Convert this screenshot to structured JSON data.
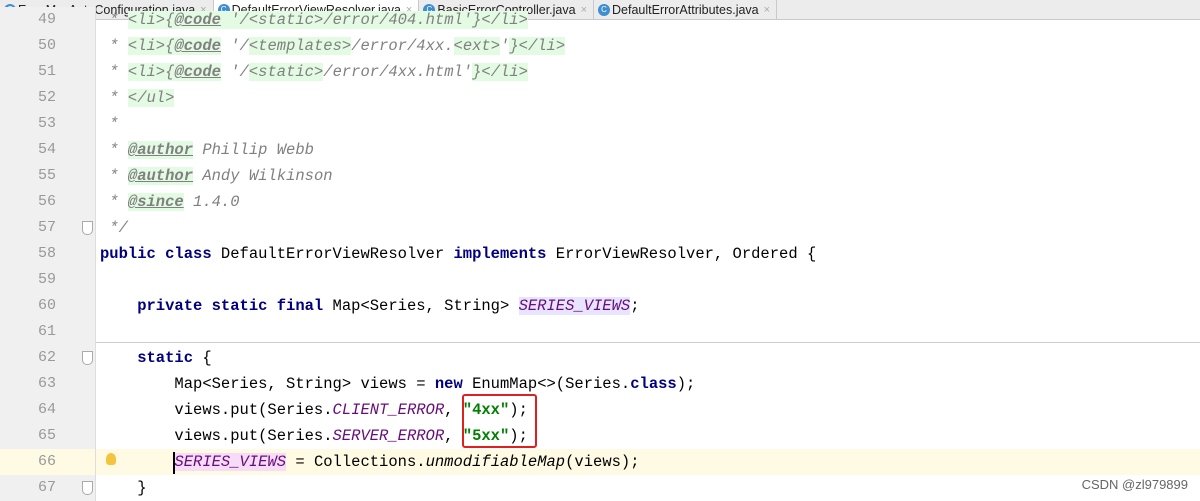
{
  "tabs": [
    {
      "label": "ErrorMvcAutoConfiguration.java",
      "active": false
    },
    {
      "label": "DefaultErrorViewResolver.java",
      "active": true
    },
    {
      "label": "BasicErrorController.java",
      "active": false
    },
    {
      "label": "DefaultErrorAttributes.java",
      "active": false
    }
  ],
  "lines": [
    {
      "n": "49",
      "t": [
        [
          " * ",
          "cm"
        ],
        [
          "<li>",
          "tg"
        ],
        [
          "{",
          "tg"
        ],
        [
          "@code",
          "tag"
        ],
        [
          " '/<static>/error/404.html'}</li>",
          "tg"
        ]
      ]
    },
    {
      "n": "50",
      "t": [
        [
          " * ",
          "cm"
        ],
        [
          "<li>",
          "tg"
        ],
        [
          "{",
          "tg"
        ],
        [
          "@code",
          "tag"
        ],
        [
          " '/",
          "cm"
        ],
        [
          "<templates>",
          "tg"
        ],
        [
          "/error/4xx.",
          "cm"
        ],
        [
          "<ext>",
          "tg"
        ],
        [
          "'",
          "cm"
        ],
        [
          "}</li>",
          "tg"
        ]
      ]
    },
    {
      "n": "51",
      "t": [
        [
          " * ",
          "cm"
        ],
        [
          "<li>",
          "tg"
        ],
        [
          "{",
          "tg"
        ],
        [
          "@code",
          "tag"
        ],
        [
          " '/",
          "cm"
        ],
        [
          "<static>",
          "tg"
        ],
        [
          "/error/4xx.html'",
          "cm"
        ],
        [
          "}</li>",
          "tg"
        ]
      ]
    },
    {
      "n": "52",
      "t": [
        [
          " * ",
          "cm"
        ],
        [
          "</ul>",
          "tg"
        ]
      ]
    },
    {
      "n": "53",
      "t": [
        [
          " *",
          "cm"
        ]
      ]
    },
    {
      "n": "54",
      "t": [
        [
          " * ",
          "cm"
        ],
        [
          "@author",
          "tag"
        ],
        [
          " Phillip Webb",
          "cm"
        ]
      ]
    },
    {
      "n": "55",
      "t": [
        [
          " * ",
          "cm"
        ],
        [
          "@author",
          "tag"
        ],
        [
          " Andy Wilkinson",
          "cm"
        ]
      ]
    },
    {
      "n": "56",
      "t": [
        [
          " * ",
          "cm"
        ],
        [
          "@since",
          "tag"
        ],
        [
          " 1.4.0",
          "cm"
        ]
      ]
    },
    {
      "n": "57",
      "t": [
        [
          " */",
          "cm"
        ]
      ],
      "fold": true
    },
    {
      "n": "58",
      "t": [
        [
          "public class ",
          "kw"
        ],
        [
          "DefaultErrorViewResolver ",
          ""
        ],
        [
          "implements ",
          "kw"
        ],
        [
          "ErrorViewResolver, Ordered {",
          ""
        ]
      ]
    },
    {
      "n": "59",
      "t": []
    },
    {
      "n": "60",
      "t": [
        [
          "    private static final ",
          "kw"
        ],
        [
          "Map<Series, String> ",
          ""
        ],
        [
          "SERIES_VIEWS",
          "sfs"
        ],
        [
          ";",
          ""
        ]
      ]
    },
    {
      "n": "61",
      "t": []
    },
    {
      "n": "62",
      "t": [
        [
          "    static ",
          "kw"
        ],
        [
          "{",
          ""
        ]
      ],
      "fold": true
    },
    {
      "n": "63",
      "t": [
        [
          "        Map<Series, String> views = ",
          ""
        ],
        [
          "new ",
          "kw"
        ],
        [
          "EnumMap<>(Series.",
          ""
        ],
        [
          "class",
          "kw"
        ],
        [
          ");",
          ""
        ]
      ]
    },
    {
      "n": "64",
      "t": [
        [
          "        views.put(Series.",
          ""
        ],
        [
          "CLIENT_ERROR",
          "sf"
        ],
        [
          ", ",
          ""
        ],
        [
          "\"4xx\"",
          "st"
        ],
        [
          ");",
          ""
        ]
      ]
    },
    {
      "n": "65",
      "t": [
        [
          "        views.put(Series.",
          ""
        ],
        [
          "SERVER_ERROR",
          "sf"
        ],
        [
          ", ",
          ""
        ],
        [
          "\"5xx\"",
          "st"
        ],
        [
          ");",
          ""
        ]
      ]
    },
    {
      "n": "66",
      "t": [
        [
          "        ",
          ""
        ],
        [
          "SERIES_VIEWS",
          "sfp"
        ],
        [
          " = Collections.",
          ""
        ],
        [
          "unmodifiableMap",
          "it"
        ],
        [
          "(views);",
          ""
        ]
      ],
      "current": true,
      "bulb": true
    },
    {
      "n": "67",
      "t": [
        [
          "    }",
          ""
        ]
      ],
      "fold": true
    }
  ],
  "watermark": "CSDN @zl979899"
}
